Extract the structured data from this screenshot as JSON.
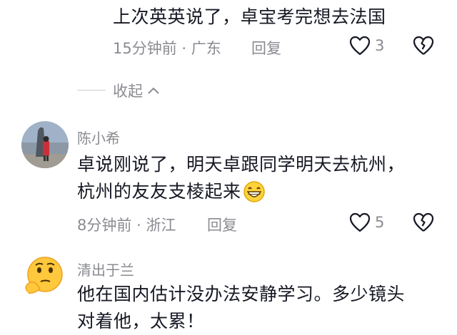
{
  "reply": {
    "text": "上次英英说了，卓宝考完想去法国",
    "time": "15分钟前",
    "location": "广东",
    "reply_label": "回复",
    "likes": "3"
  },
  "collapse_label": "收起",
  "comments": [
    {
      "username": "陈小希",
      "line1": "卓说刚说了，明天卓跟同学明天去杭州，",
      "line2": "杭州的友友支棱起来",
      "emoji": "grinning-emoji",
      "time": "8分钟前",
      "location": "浙江",
      "reply_label": "回复",
      "likes": "5"
    },
    {
      "username": "清出于兰",
      "line1": "他在国内估计没办法安静学习。多少镜头",
      "line2": "对着他，太累！"
    }
  ],
  "icons": {
    "heart": "heart-outline-icon",
    "broken_heart": "broken-heart-icon",
    "chevron": "chevron-up-icon"
  },
  "colors": {
    "text": "#161823",
    "meta": "#8a8b91"
  }
}
